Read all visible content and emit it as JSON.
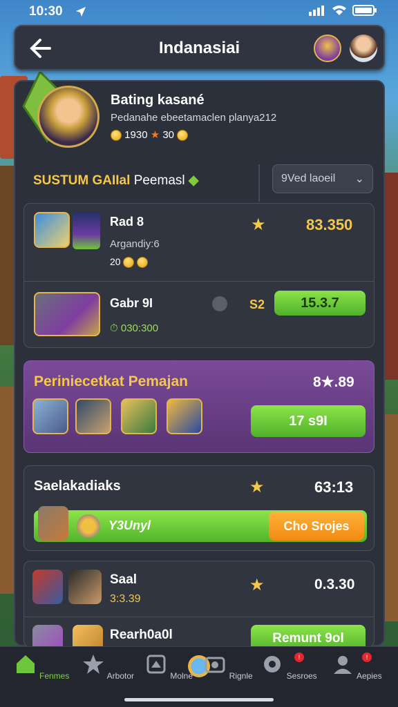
{
  "status_bar": {
    "time": "10:30"
  },
  "header": {
    "title": "Indanasiai"
  },
  "profile": {
    "name": "Bating kasané",
    "subtitle": "Pedanahe ebeetamaclen planya212",
    "coins": "1930",
    "stars": "30"
  },
  "section": {
    "title_highlight": "SUSTUM GAIIal",
    "title_rest": "Peemasl",
    "dropdown_label": "9Ved laoeil"
  },
  "rows": [
    {
      "name": "Rad 8",
      "sub": "Argandiy:6",
      "sub2": "20",
      "score": "83.350"
    },
    {
      "name": "Gabr 9I",
      "sub": "030:300",
      "score_label": "S2",
      "value": "15.3.7"
    }
  ],
  "featured": {
    "title": "Periniecetkat Pemajan",
    "score": "8★.89",
    "button": "17 s9I"
  },
  "challenge": {
    "title": "Saelakadiaks",
    "score": "63:13",
    "bar_label": "Y3Unyl",
    "button": "Cho Srojes"
  },
  "list": [
    {
      "name": "Saal",
      "sub": "3:3.39",
      "score": "0.3.30"
    },
    {
      "name": "Rearh0a0l",
      "button": "Remunt 9ol"
    }
  ],
  "nav": [
    {
      "label": "Fenmes",
      "icon": "home-icon",
      "active": true
    },
    {
      "label": "Arbotor",
      "icon": "star-icon"
    },
    {
      "label": "Molne",
      "icon": "map-icon"
    },
    {
      "label": "Rignle",
      "icon": "globe-icon"
    },
    {
      "label": "Sesroes",
      "icon": "settings-icon",
      "badge": "!"
    },
    {
      "label": "Aepies",
      "icon": "profile-icon",
      "badge": "!"
    }
  ],
  "colors": {
    "accent_green": "#6ccb35",
    "gold": "#f5c84a",
    "purple": "#6c3f8a",
    "orange": "#f39a1f",
    "panel": "#2b303b"
  }
}
